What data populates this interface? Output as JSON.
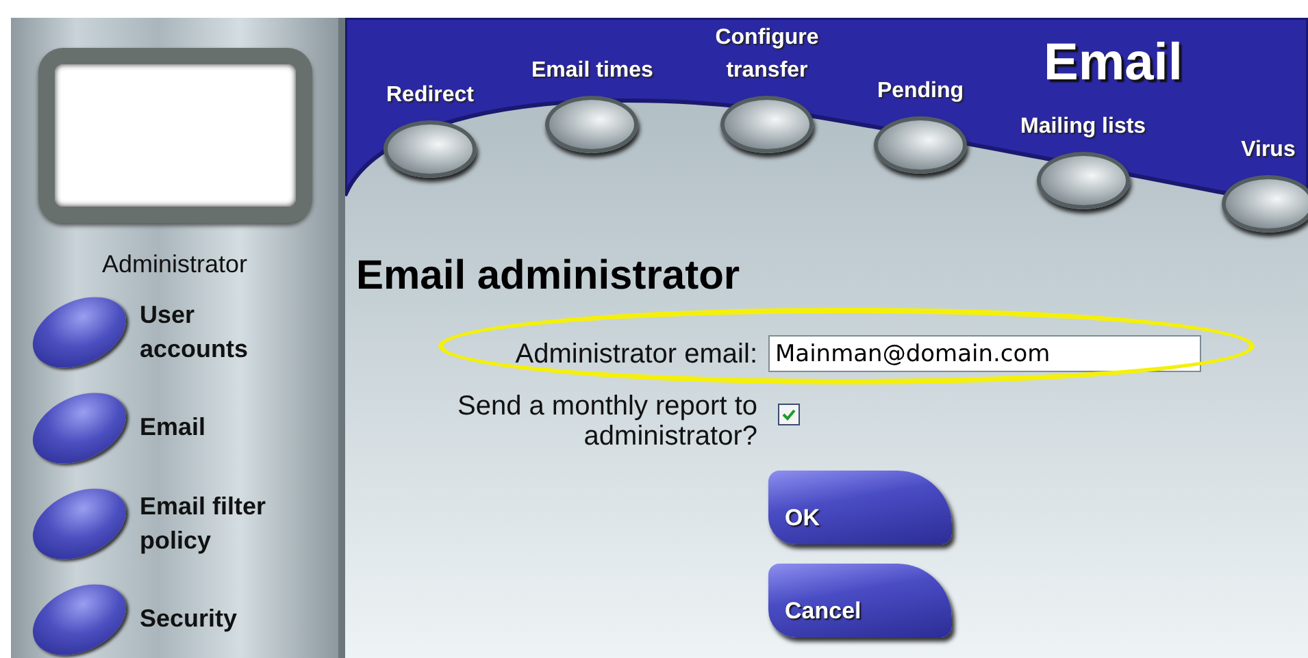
{
  "nav": [
    {
      "label": "Redirect"
    },
    {
      "label": "Email times"
    },
    {
      "label": "Configure transfer"
    },
    {
      "label": "Pending"
    },
    {
      "label": "Mailing lists"
    },
    {
      "label": "Virus"
    }
  ],
  "section_title": "Email",
  "sidebar": {
    "user_label": "Administrator",
    "items": [
      {
        "label": "User accounts"
      },
      {
        "label": "Email"
      },
      {
        "label": "Email filter policy"
      },
      {
        "label": "Security"
      }
    ]
  },
  "page_title": "Email administrator",
  "form": {
    "email_label": "Administrator email:",
    "email_value": "Mainman@domain.com",
    "report_label": "Send a monthly report to administrator?",
    "report_checked": true
  },
  "buttons": [
    {
      "label": "OK"
    },
    {
      "label": "Cancel"
    }
  ]
}
